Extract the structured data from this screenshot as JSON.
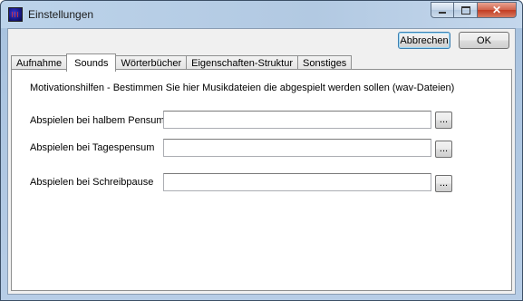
{
  "window": {
    "title": "Einstellungen",
    "icon": "app-icon",
    "controls": {
      "minimize": "minimize-icon",
      "maximize": "maximize-icon",
      "close": "close-icon"
    }
  },
  "actions": {
    "cancel_label": "Abbrechen",
    "ok_label": "OK"
  },
  "tabs": [
    {
      "label": "Aufnahme",
      "active": false
    },
    {
      "label": "Sounds",
      "active": true
    },
    {
      "label": "Wörterbücher",
      "active": false
    },
    {
      "label": "Eigenschaften-Struktur",
      "active": false
    },
    {
      "label": "Sonstiges",
      "active": false
    }
  ],
  "sounds": {
    "description": "Motivationshilfen - Bestimmen Sie hier Musikdateien die abgespielt werden sollen (wav-Dateien)",
    "rows": [
      {
        "label": "Abspielen bei halbem Pensum",
        "value": "",
        "browse": "..."
      },
      {
        "label": "Abspielen bei Tagespensum",
        "value": "",
        "browse": "..."
      },
      {
        "label": "Abspielen bei Schreibpause",
        "value": "",
        "browse": "..."
      }
    ]
  }
}
